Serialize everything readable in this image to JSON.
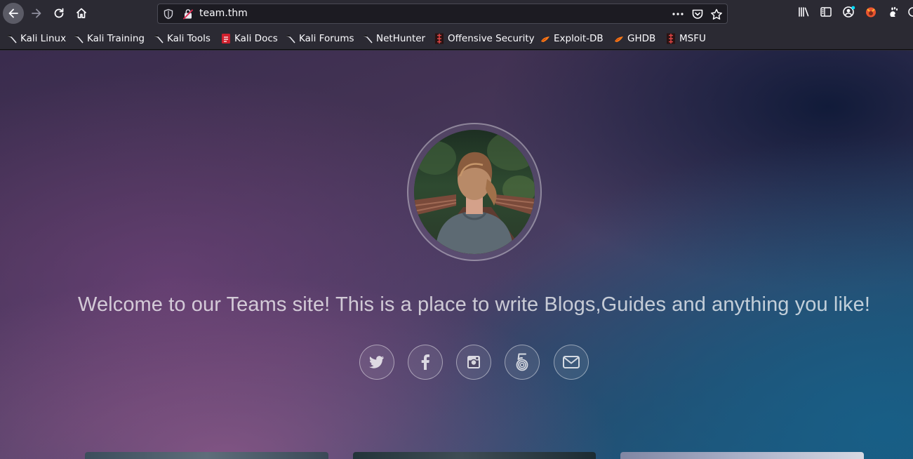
{
  "browser": {
    "url": "team.thm",
    "bookmarks": [
      {
        "label": "Kali Linux",
        "icon": "kali-dragon-icon"
      },
      {
        "label": "Kali Training",
        "icon": "kali-dragon-icon"
      },
      {
        "label": "Kali Tools",
        "icon": "kali-dragon-icon"
      },
      {
        "label": "Kali Docs",
        "icon": "kali-docs-icon"
      },
      {
        "label": "Kali Forums",
        "icon": "kali-dragon-icon"
      },
      {
        "label": "NetHunter",
        "icon": "kali-dragon-icon"
      },
      {
        "label": "Offensive Security",
        "icon": "offsec-icon"
      },
      {
        "label": "Exploit-DB",
        "icon": "exploit-db-icon"
      },
      {
        "label": "GHDB",
        "icon": "exploit-db-icon"
      },
      {
        "label": "MSFU",
        "icon": "offsec-icon"
      }
    ]
  },
  "page": {
    "welcome": "Welcome to our Teams site! This is a place to write Blogs,Guides and anything you like!",
    "socials": [
      "twitter-icon",
      "facebook-icon",
      "instagram-icon",
      "500px-icon",
      "email-icon"
    ]
  },
  "colors": {
    "toolbar_bg": "#2b2a33",
    "urlbar_bg": "#1c1b22",
    "text": "#fbfbfe"
  }
}
